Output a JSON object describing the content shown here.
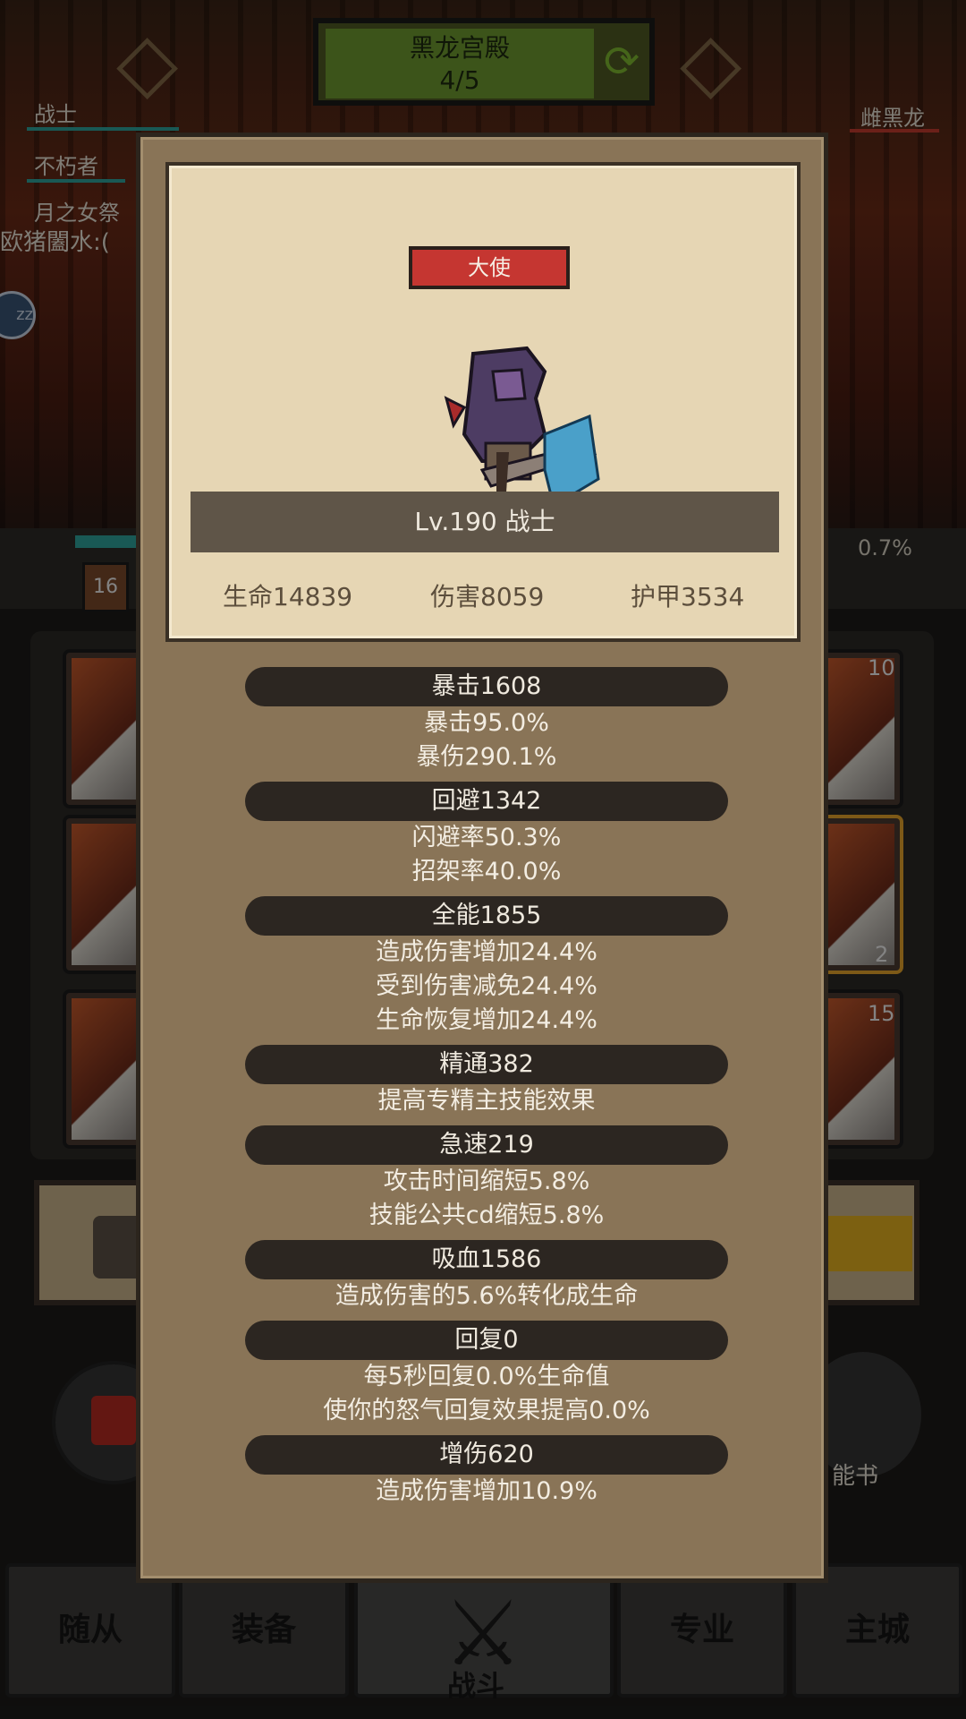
{
  "stage": {
    "name": "黑龙宫殿",
    "progress": "4/5",
    "refresh_icon": "refresh-icon"
  },
  "party": [
    "战士",
    "不朽者",
    "月之女祭"
  ],
  "enemy": "雌黑龙",
  "chat": "欧猪闔水:(",
  "bubble": "zz",
  "hp_percent": "0.7%",
  "level_badge": "16",
  "slot_numbers": [
    "10",
    "2",
    "15"
  ],
  "skillbook_label": "能书",
  "nav": {
    "follower": "随从",
    "equipment": "装备",
    "battle": "战斗",
    "profession": "专业",
    "city": "主城"
  },
  "modal": {
    "title_badge": "大使",
    "level_line": "Lv.190 战士",
    "stats": {
      "hp": "生命14839",
      "damage": "伤害8059",
      "armor": "护甲3534"
    },
    "sections": [
      {
        "head": "暴击1608",
        "lines": [
          "暴击95.0%",
          "暴伤290.1%"
        ]
      },
      {
        "head": "回避1342",
        "lines": [
          "闪避率50.3%",
          "招架率40.0%"
        ]
      },
      {
        "head": "全能1855",
        "lines": [
          "造成伤害增加24.4%",
          "受到伤害减免24.4%",
          "生命恢复增加24.4%"
        ]
      },
      {
        "head": "精通382",
        "lines": [
          "提高专精主技能效果"
        ]
      },
      {
        "head": "急速219",
        "lines": [
          "攻击时间缩短5.8%",
          "技能公共cd缩短5.8%"
        ]
      },
      {
        "head": "吸血1586",
        "lines": [
          "造成伤害的5.6%转化成生命"
        ]
      },
      {
        "head": "回复0",
        "lines": [
          "每5秒回复0.0%生命值",
          "使你的怒气回复效果提高0.0%"
        ]
      },
      {
        "head": "增伤620",
        "lines": [
          "造成伤害增加10.9%"
        ]
      }
    ]
  },
  "colors": {
    "modal_bg": "#897457",
    "card_bg": "#e6d6b4",
    "badge_red": "#c53631",
    "pill": "#2c2621"
  }
}
